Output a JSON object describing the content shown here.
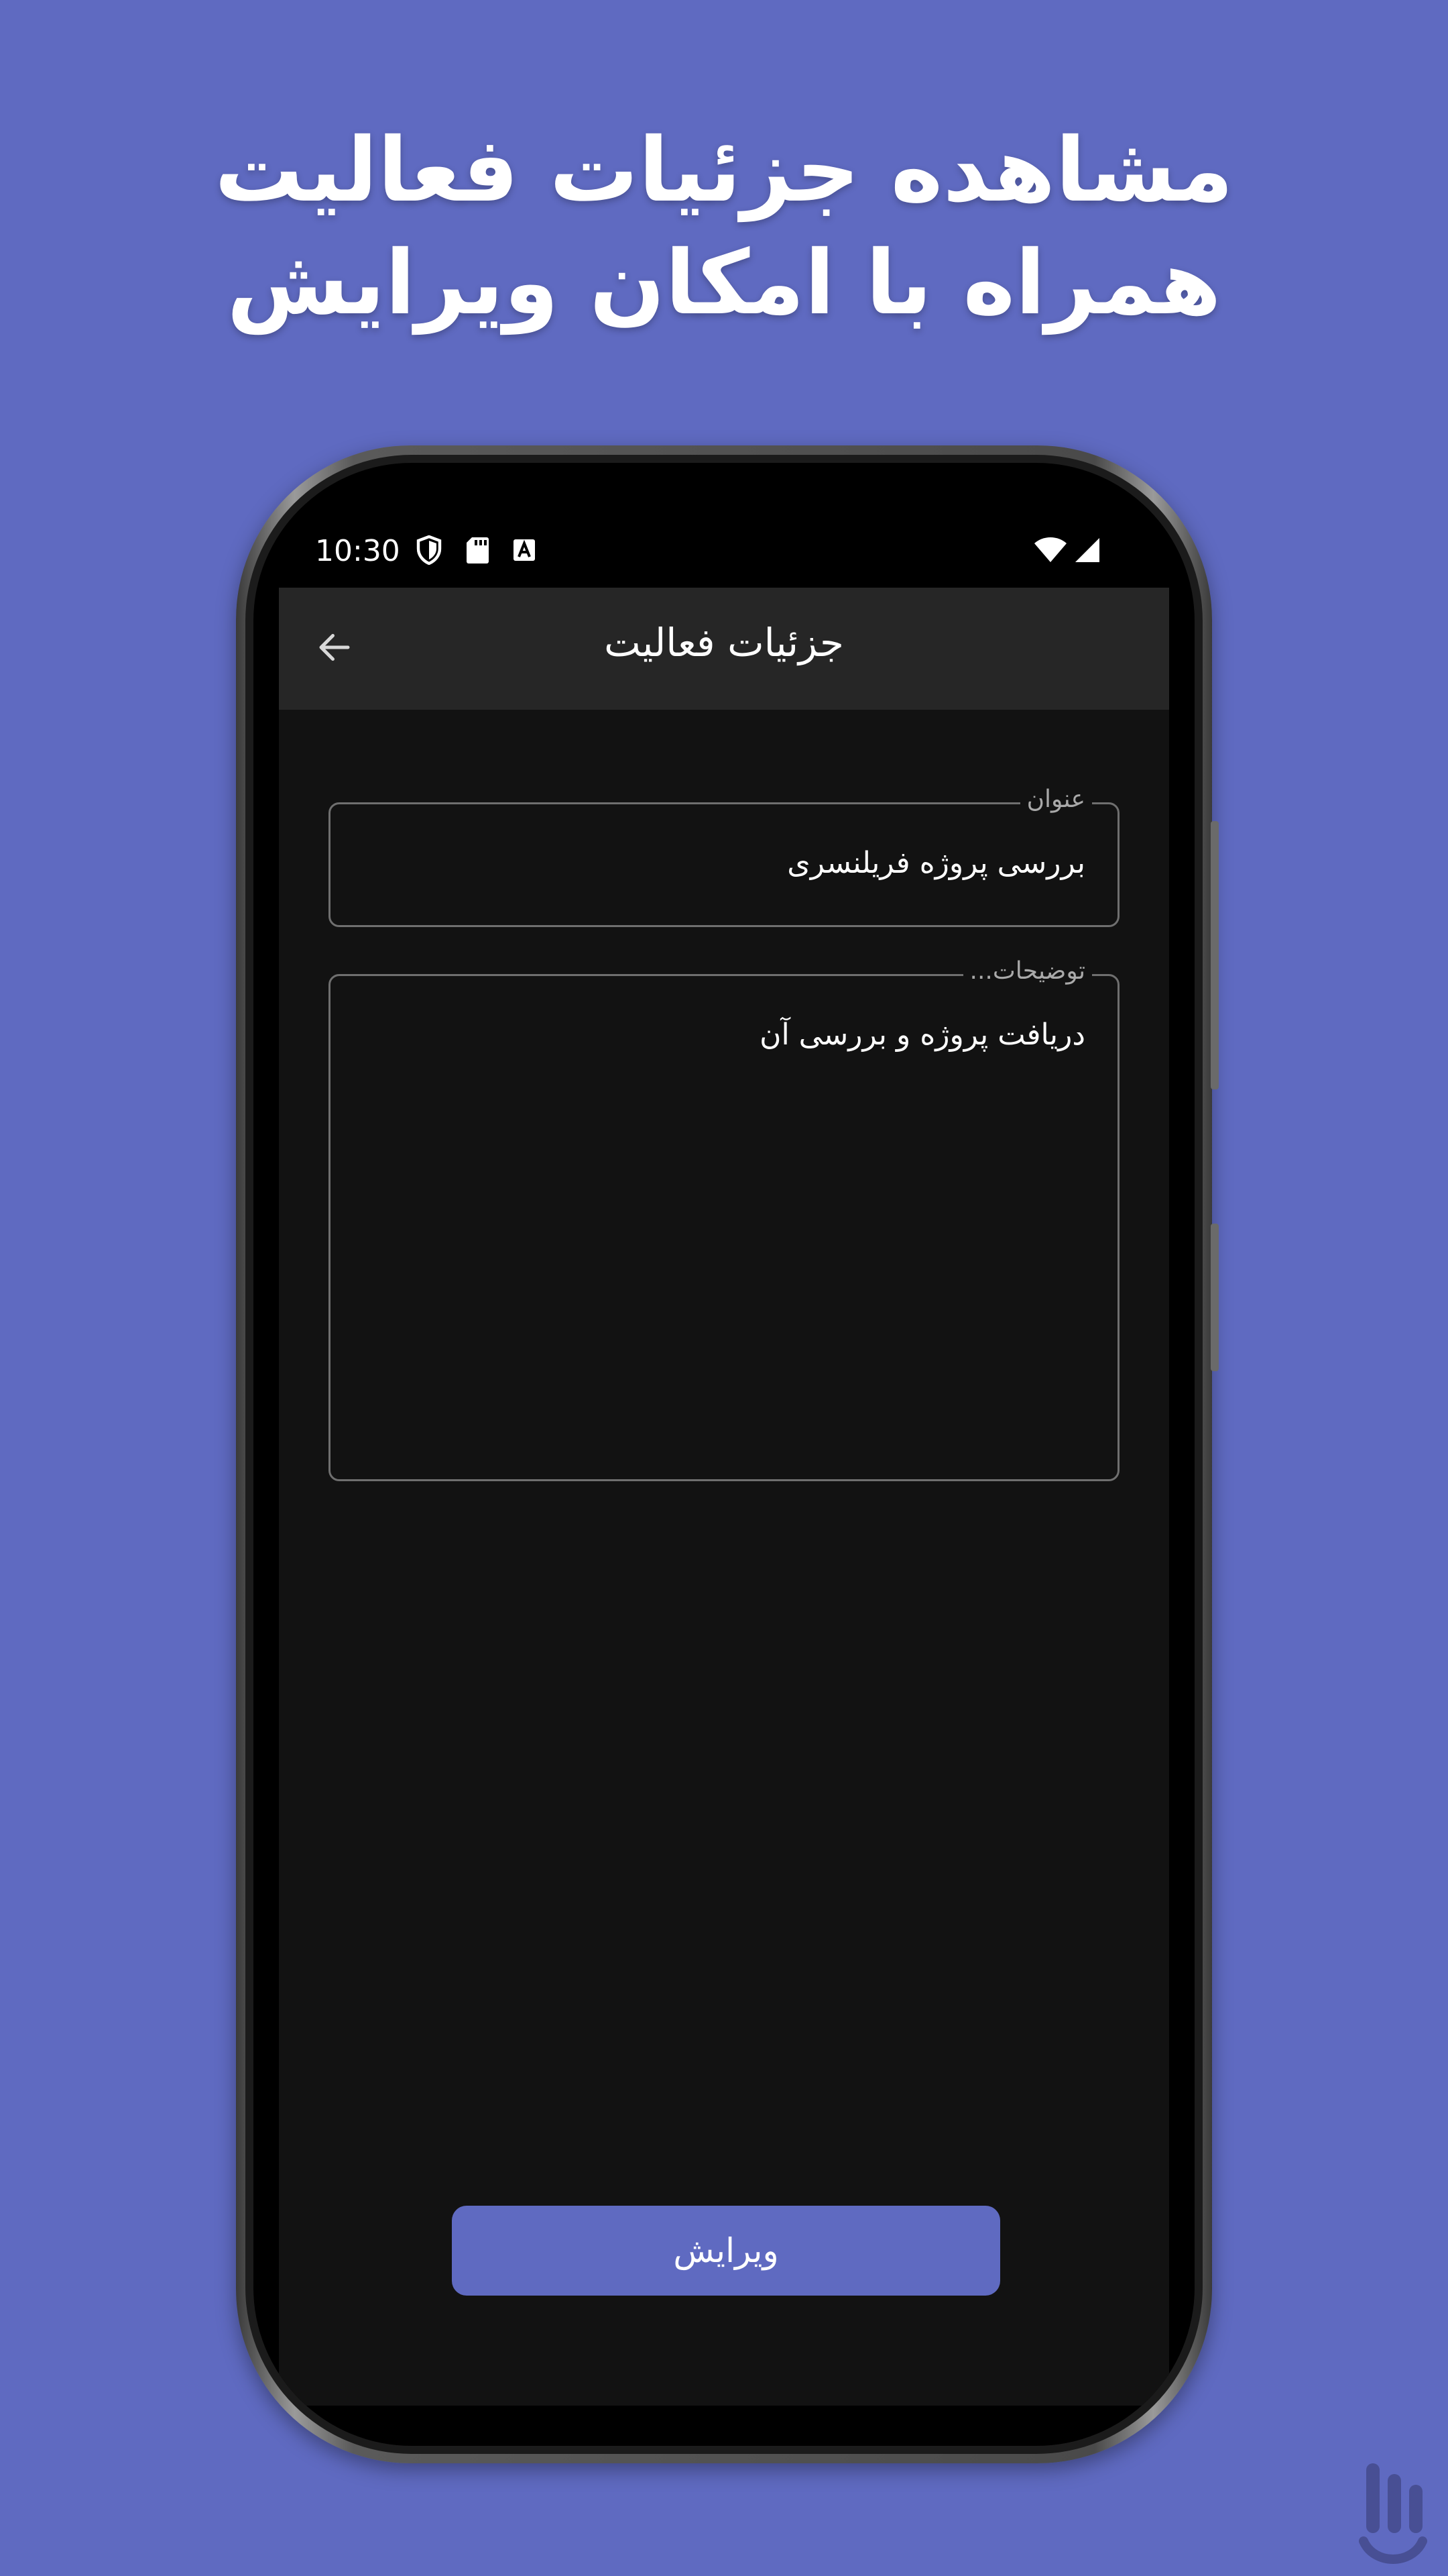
{
  "headline": {
    "line1": "مشاهده جزئیات فعالیت",
    "line2": "همراه با امکان ویرایش"
  },
  "status_bar": {
    "time": "10:30",
    "icons_left": [
      "shield-icon",
      "sd-card-icon",
      "font-a-icon"
    ],
    "icons_right": [
      "wifi-icon",
      "signal-icon"
    ]
  },
  "app_bar": {
    "title": "جزئیات فعالیت",
    "back_icon": "arrow-left-icon"
  },
  "form": {
    "title_field": {
      "label": "عنوان",
      "value": "بررسی پروژه فریلنسری"
    },
    "description_field": {
      "label": "توضیحات...",
      "value": "دریافت پروژه و بررسی آن"
    }
  },
  "actions": {
    "edit_label": "ویرایش"
  },
  "colors": {
    "background": "#5f6ac1",
    "accent": "#5f6ac1",
    "app_bar": "#262626",
    "screen": "#121212",
    "field_border": "#6f6f6f"
  }
}
